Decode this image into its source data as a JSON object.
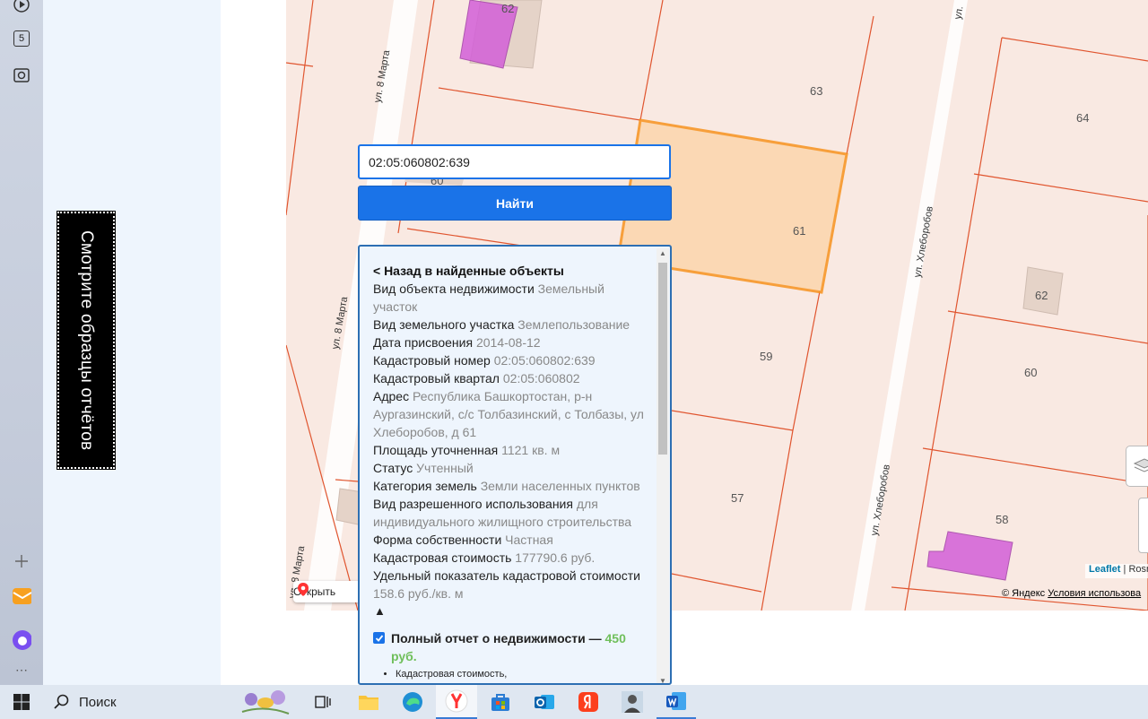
{
  "sidebar": {
    "tab_count": "5"
  },
  "promo": {
    "text": "Смотрите образцы отчётов"
  },
  "map": {
    "streets": [
      "ул. 8 Марта",
      "ул. 8 Марта",
      "ул. 8 Марта",
      "ул. Хлеборобов",
      "ул. Хлеборобов",
      "ул."
    ],
    "parcels": [
      "62",
      "63",
      "64",
      "60",
      "61",
      "62",
      "59",
      "60",
      "57",
      "58"
    ],
    "open_label": "Открыть",
    "attribution_leaflet": "Leaflet",
    "attribution_sep": "| Rosr",
    "copyright": "© Яндекс",
    "terms": "Условия использова"
  },
  "search": {
    "value": "02:05:060802:639",
    "button": "Найти"
  },
  "panel": {
    "back": "< Назад в найденные объекты",
    "rows": [
      {
        "label": "Вид объекта недвижимости",
        "value": "Земельный участок"
      },
      {
        "label": "Вид земельного участка",
        "value": "Землепользование"
      },
      {
        "label": "Дата присвоения",
        "value": "2014-08-12"
      },
      {
        "label": "Кадастровый номер",
        "value": "02:05:060802:639"
      },
      {
        "label": "Кадастровый квартал",
        "value": "02:05:060802"
      },
      {
        "label": "Адрес",
        "value": "Республика Башкортостан, р-н Аургазинский, с/с Толбазинский, с Толбазы, ул Хлеборобов, д 61"
      },
      {
        "label": "Площадь уточненная",
        "value": "1121 кв. м"
      },
      {
        "label": "Статус",
        "value": "Учтенный"
      },
      {
        "label": "Категория земель",
        "value": "Земли населенных пунктов"
      },
      {
        "label": "Вид разрешенного использования",
        "value": "для индивидуального жилищного строительства"
      },
      {
        "label": "Форма собственности",
        "value": "Частная"
      },
      {
        "label": "Кадастровая стоимость",
        "value": "177790.6 руб."
      },
      {
        "label": "Удельный показатель кадастровой стоимости",
        "value": "158.6 руб./кв. м"
      }
    ],
    "collapse": "▲",
    "report_label": "Полный отчет о недвижимости —",
    "report_price": "450 руб.",
    "report_item": "Кадастровая стоимость,"
  },
  "taskbar": {
    "search_label": "Поиск"
  },
  "colors": {
    "accent": "#1a73e8",
    "parcel_line": "#e0552f",
    "selected": "#f7931e",
    "building": "#d35fd8",
    "price": "#6fbf5b"
  }
}
